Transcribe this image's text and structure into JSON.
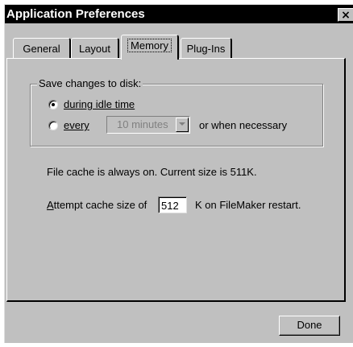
{
  "window": {
    "title": "Application Preferences",
    "close_glyph": "×"
  },
  "tabs": [
    {
      "label": "General",
      "active": false
    },
    {
      "label": "Layout",
      "active": false
    },
    {
      "label": "Memory",
      "active": true
    },
    {
      "label": "Plug-Ins",
      "active": false
    }
  ],
  "memory": {
    "save_group_label": "Save changes to disk:",
    "option_idle_label": "during idle time",
    "option_idle_selected": true,
    "option_every_label": "every",
    "option_every_selected": false,
    "interval_value": "10 minutes",
    "or_when_label": "or when necessary",
    "file_cache_text": "File cache is always on.  Current size is 511K.",
    "attempt_label": "Attempt cache size of",
    "cache_size_value": "512",
    "restart_label": "K on FileMaker restart."
  },
  "buttons": {
    "done_label": "Done"
  },
  "colors": {
    "titlebar": "#000000",
    "face": "#c0c0c0",
    "disabled_text": "#808080"
  }
}
